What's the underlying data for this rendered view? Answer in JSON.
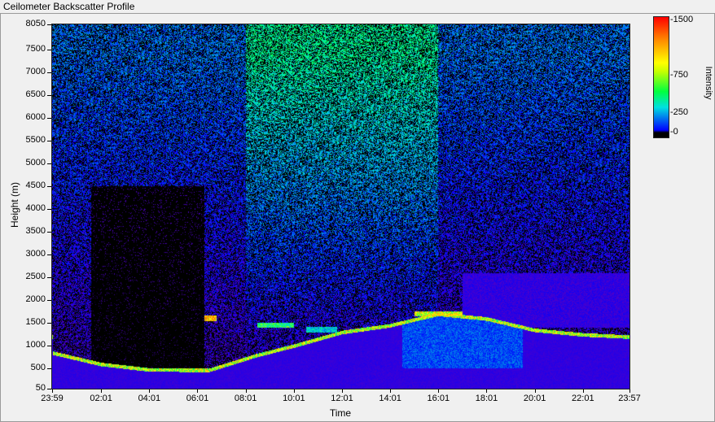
{
  "window": {
    "title": "Ceilometer Backscatter Profile"
  },
  "chart_data": {
    "type": "heatmap",
    "xlabel": "Time",
    "ylabel": "Height (m)",
    "x_ticks": [
      "23:59",
      "02:01",
      "04:01",
      "06:01",
      "08:01",
      "10:01",
      "12:01",
      "14:01",
      "16:01",
      "18:01",
      "20:01",
      "22:01",
      "23:57"
    ],
    "x_tick_hours": [
      -0.017,
      2.017,
      4.017,
      6.017,
      8.017,
      10.017,
      12.017,
      14.017,
      16.017,
      18.017,
      20.017,
      22.017,
      23.95
    ],
    "x_range_hours": [
      -0.017,
      23.95
    ],
    "y_ticks": [
      50,
      500,
      1000,
      1500,
      2000,
      2500,
      3000,
      3500,
      4000,
      4500,
      5000,
      5500,
      6000,
      6500,
      7000,
      7500,
      8050
    ],
    "ylim": [
      50,
      8050
    ],
    "colorbar": {
      "label": "Intensity",
      "ticks": [
        0,
        250,
        750,
        1500
      ],
      "range": [
        0,
        1500
      ],
      "colors": [
        "#000000",
        "#0000ff",
        "#00e0e0",
        "#00ff40",
        "#ffff00",
        "#ff9000",
        "#ff0000"
      ]
    },
    "features": {
      "boundary_layer_top_m": [
        {
          "time_h": 0.0,
          "height_m": 800
        },
        {
          "time_h": 2.0,
          "height_m": 550
        },
        {
          "time_h": 4.0,
          "height_m": 430
        },
        {
          "time_h": 6.5,
          "height_m": 420
        },
        {
          "time_h": 8.5,
          "height_m": 750
        },
        {
          "time_h": 10.0,
          "height_m": 950
        },
        {
          "time_h": 12.0,
          "height_m": 1250
        },
        {
          "time_h": 14.0,
          "height_m": 1400
        },
        {
          "time_h": 16.0,
          "height_m": 1650
        },
        {
          "time_h": 18.0,
          "height_m": 1550
        },
        {
          "time_h": 20.0,
          "height_m": 1300
        },
        {
          "time_h": 22.0,
          "height_m": 1200
        },
        {
          "time_h": 23.95,
          "height_m": 1150
        }
      ],
      "cloud_layers": [
        {
          "start_h": 6.3,
          "end_h": 6.8,
          "height_m": 1600,
          "intensity": 1400
        },
        {
          "start_h": 8.5,
          "end_h": 10.0,
          "height_m": 1450,
          "intensity": 900
        },
        {
          "start_h": 10.5,
          "end_h": 11.8,
          "height_m": 1350,
          "intensity": 700
        },
        {
          "start_h": 15.0,
          "end_h": 17.0,
          "height_m": 1700,
          "intensity": 1200
        }
      ]
    }
  }
}
